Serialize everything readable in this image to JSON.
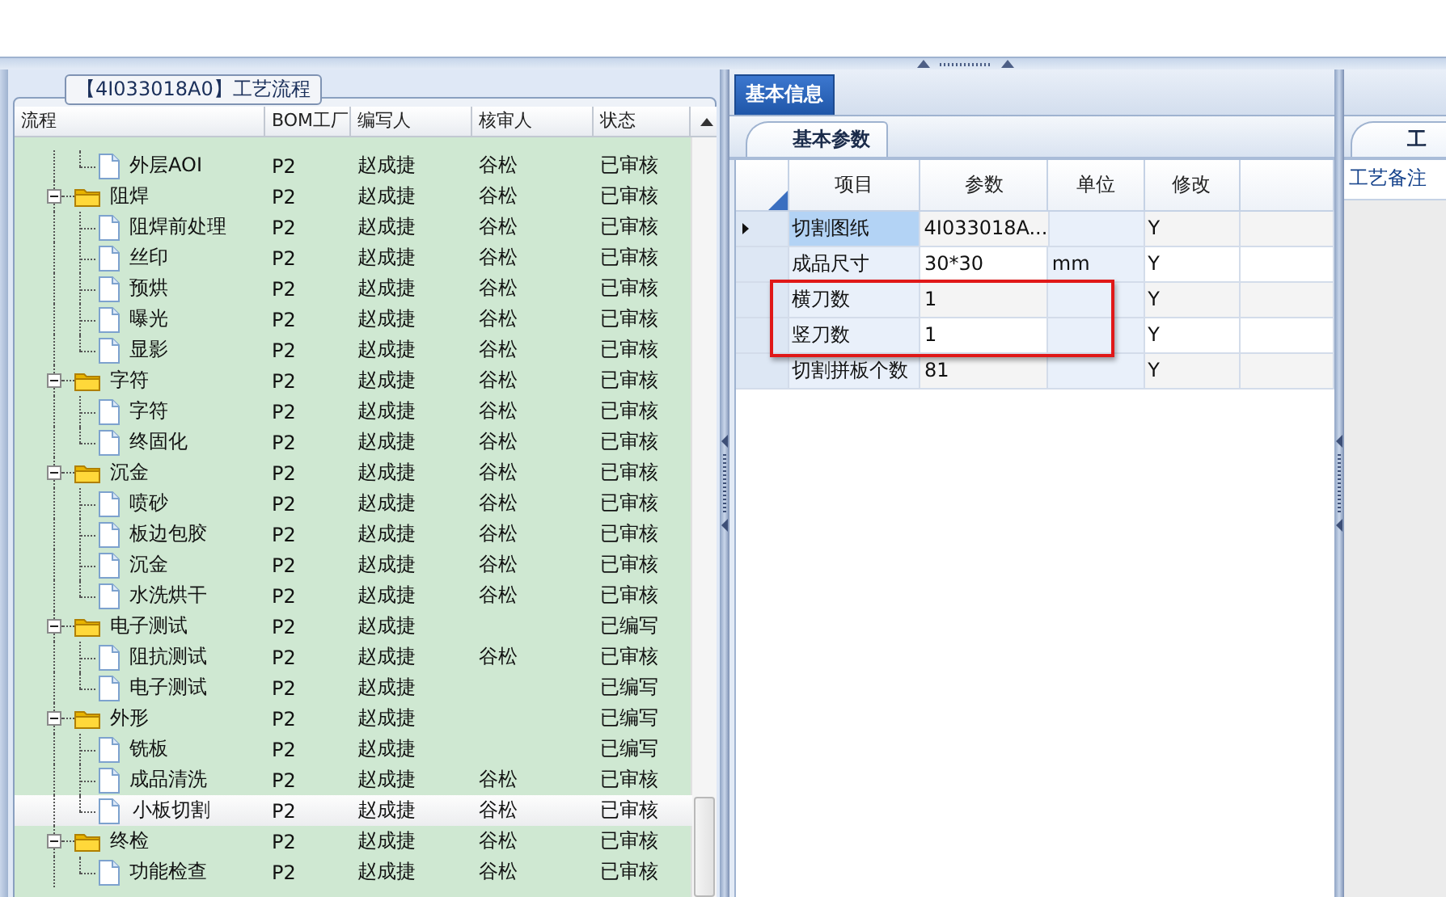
{
  "group_title": "【4I033018A0】工艺流程",
  "tree": {
    "columns": [
      "流程",
      "BOM工厂",
      "编写人",
      "核审人",
      "状态"
    ],
    "items": [
      {
        "children": [
          {
            "label": "外层AOI",
            "factory": "P2",
            "author": "赵成捷",
            "reviewer": "谷松",
            "status": "已审核",
            "selected": false
          }
        ]
      },
      {
        "label": "阻焊",
        "factory": "P2",
        "author": "赵成捷",
        "reviewer": "谷松",
        "status": "已审核",
        "expanded": true,
        "children": [
          {
            "label": "阻焊前处理",
            "factory": "P2",
            "author": "赵成捷",
            "reviewer": "谷松",
            "status": "已审核",
            "selected": false
          },
          {
            "label": "丝印",
            "factory": "P2",
            "author": "赵成捷",
            "reviewer": "谷松",
            "status": "已审核",
            "selected": false
          },
          {
            "label": "预烘",
            "factory": "P2",
            "author": "赵成捷",
            "reviewer": "谷松",
            "status": "已审核",
            "selected": false
          },
          {
            "label": "曝光",
            "factory": "P2",
            "author": "赵成捷",
            "reviewer": "谷松",
            "status": "已审核",
            "selected": false
          },
          {
            "label": "显影",
            "factory": "P2",
            "author": "赵成捷",
            "reviewer": "谷松",
            "status": "已审核",
            "selected": false
          }
        ]
      },
      {
        "label": "字符",
        "factory": "P2",
        "author": "赵成捷",
        "reviewer": "谷松",
        "status": "已审核",
        "expanded": true,
        "children": [
          {
            "label": "字符",
            "factory": "P2",
            "author": "赵成捷",
            "reviewer": "谷松",
            "status": "已审核",
            "selected": false
          },
          {
            "label": "终固化",
            "factory": "P2",
            "author": "赵成捷",
            "reviewer": "谷松",
            "status": "已审核",
            "selected": false
          }
        ]
      },
      {
        "label": "沉金",
        "factory": "P2",
        "author": "赵成捷",
        "reviewer": "谷松",
        "status": "已审核",
        "expanded": true,
        "children": [
          {
            "label": "喷砂",
            "factory": "P2",
            "author": "赵成捷",
            "reviewer": "谷松",
            "status": "已审核",
            "selected": false
          },
          {
            "label": "板边包胶",
            "factory": "P2",
            "author": "赵成捷",
            "reviewer": "谷松",
            "status": "已审核",
            "selected": false
          },
          {
            "label": "沉金",
            "factory": "P2",
            "author": "赵成捷",
            "reviewer": "谷松",
            "status": "已审核",
            "selected": false
          },
          {
            "label": "水洗烘干",
            "factory": "P2",
            "author": "赵成捷",
            "reviewer": "谷松",
            "status": "已审核",
            "selected": false
          }
        ]
      },
      {
        "label": "电子测试",
        "factory": "P2",
        "author": "赵成捷",
        "status": "已编写",
        "expanded": true,
        "children": [
          {
            "label": "阻抗测试",
            "factory": "P2",
            "author": "赵成捷",
            "reviewer": "谷松",
            "status": "已审核",
            "selected": false
          },
          {
            "label": "电子测试",
            "factory": "P2",
            "author": "赵成捷",
            "status": "已编写",
            "selected": false
          }
        ]
      },
      {
        "label": "外形",
        "factory": "P2",
        "author": "赵成捷",
        "status": "已编写",
        "expanded": true,
        "children": [
          {
            "label": "铣板",
            "factory": "P2",
            "author": "赵成捷",
            "status": "已编写",
            "selected": false
          },
          {
            "label": "成品清洗",
            "factory": "P2",
            "author": "赵成捷",
            "reviewer": "谷松",
            "status": "已审核",
            "selected": false
          },
          {
            "label": "小板切割",
            "factory": "P2",
            "author": "赵成捷",
            "reviewer": "谷松",
            "status": "已审核",
            "selected": true
          }
        ]
      },
      {
        "label": "终检",
        "factory": "P2",
        "author": "赵成捷",
        "reviewer": "谷松",
        "status": "已审核",
        "expanded": true,
        "children": [
          {
            "label": "功能检查",
            "factory": "P2",
            "author": "赵成捷",
            "reviewer": "谷松",
            "status": "已审核",
            "selected": false
          }
        ]
      }
    ]
  },
  "tabs": [
    {
      "label": "基本信息",
      "selected": true
    }
  ],
  "sub_tabs": [
    {
      "label": "基本参数",
      "selected": true
    }
  ],
  "params": {
    "columns": [
      "项目",
      "参数",
      "单位",
      "修改"
    ],
    "rows": [
      {
        "item": "切割图纸",
        "value": "4I033018A...",
        "modify": "Y",
        "selected": true,
        "highlighted": false
      },
      {
        "item": "成品尺寸",
        "value": "30*30",
        "unit": "mm",
        "modify": "Y",
        "selected": false,
        "highlighted": false
      },
      {
        "item": "横刀数",
        "value": "1",
        "modify": "Y",
        "selected": false,
        "highlighted": true
      },
      {
        "item": "竖刀数",
        "value": "1",
        "modify": "Y",
        "selected": false,
        "highlighted": true
      },
      {
        "item": "切割拼板个数",
        "value": "81",
        "modify": "Y",
        "selected": false,
        "highlighted": false
      }
    ]
  },
  "side_tabs": [
    {
      "label": "工",
      "selected": true
    }
  ],
  "notes_label": "工艺备注"
}
